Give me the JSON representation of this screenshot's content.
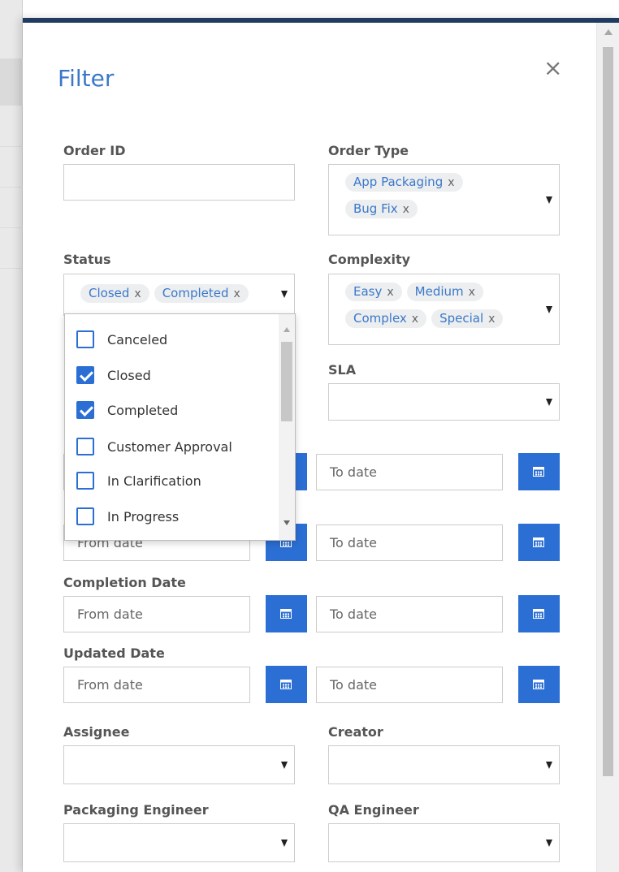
{
  "title": "Filter",
  "close_glyph": "×",
  "fields": {
    "order_id": {
      "label": "Order ID",
      "value": ""
    },
    "order_type": {
      "label": "Order Type",
      "tags": [
        "App Packaging",
        "Bug Fix"
      ]
    },
    "status": {
      "label": "Status",
      "tags": [
        "Closed",
        "Completed"
      ]
    },
    "complexity": {
      "label": "Complexity",
      "tags": [
        "Easy",
        "Medium",
        "Complex",
        "Special"
      ]
    },
    "sla": {
      "label": "SLA",
      "value": ""
    },
    "completion_date": {
      "label": "Completion Date"
    },
    "updated_date": {
      "label": "Updated Date"
    },
    "assignee": {
      "label": "Assignee",
      "value": ""
    },
    "creator": {
      "label": "Creator",
      "value": ""
    },
    "packaging_engineer": {
      "label": "Packaging Engineer",
      "value": ""
    },
    "qa_engineer": {
      "label": "QA Engineer",
      "value": ""
    }
  },
  "tag_remove": "x",
  "date_placeholders": {
    "from": "From date",
    "to": "To date"
  },
  "status_options": [
    {
      "label": "Canceled",
      "checked": false
    },
    {
      "label": "Closed",
      "checked": true
    },
    {
      "label": "Completed",
      "checked": true
    },
    {
      "label": "Customer Approval",
      "checked": false
    },
    {
      "label": "In Clarification",
      "checked": false
    },
    {
      "label": "In Progress",
      "checked": false
    }
  ],
  "colors": {
    "accent": "#2b6fd4",
    "title": "#3a78c9",
    "header_bar": "#1f3b60",
    "tag_bg": "#eceef0"
  },
  "icons": {
    "close": "close-icon",
    "calendar": "calendar-icon",
    "dropdown": "chevron-down-icon",
    "check": "check-icon"
  }
}
